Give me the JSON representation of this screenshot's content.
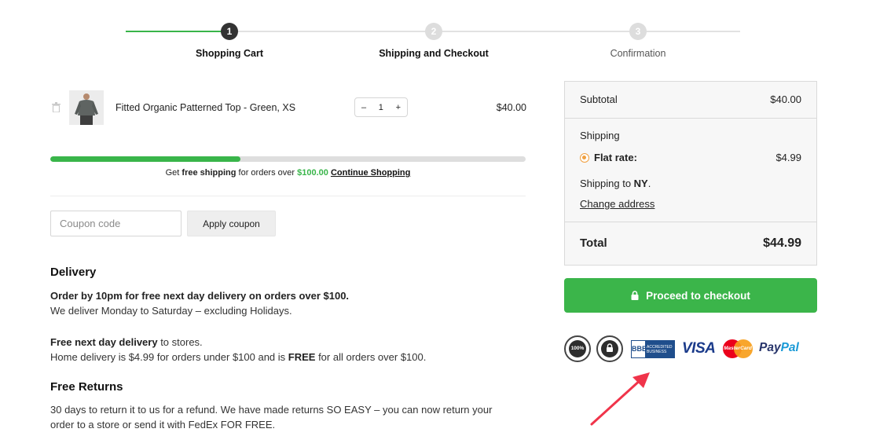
{
  "steps": [
    {
      "number": "1",
      "label": "Shopping Cart",
      "state": "active"
    },
    {
      "number": "2",
      "label": "Shipping and Checkout",
      "state": "upcoming"
    },
    {
      "number": "3",
      "label": "Confirmation",
      "state": "upcoming"
    }
  ],
  "cart": {
    "item": {
      "name": "Fitted Organic Patterned Top - Green, XS",
      "quantity": "1",
      "minus": "–",
      "plus": "+",
      "price": "$40.00",
      "icons": {
        "remove": "trash-icon",
        "thumbnail": "product-thumbnail"
      }
    }
  },
  "free_shipping": {
    "progress": 0.4,
    "text_pre": "Get ",
    "text_bold": "free shipping",
    "text_mid": " for orders over ",
    "threshold": "$100.00",
    "link": "Continue Shopping"
  },
  "coupon": {
    "placeholder": "Coupon code",
    "button": "Apply coupon"
  },
  "delivery": {
    "heading": "Delivery",
    "line1": "Order by 10pm for free next day delivery on orders over $100.",
    "line2": "We deliver Monday to Saturday – excluding Holidays.",
    "line3_bold": "Free next day delivery",
    "line3_rest": " to stores.",
    "line4_pre": "Home delivery is $4.99 for orders under $100 and is ",
    "line4_bold": "FREE",
    "line4_post": " for all orders over $100."
  },
  "returns": {
    "heading": "Free Returns",
    "line1": "30 days to return it to us for a refund. We have made returns SO EASY – you can now return your",
    "line2": "order to a store or send it with FedEx FOR FREE."
  },
  "totals": {
    "subtotal_label": "Subtotal",
    "subtotal_value": "$40.00",
    "shipping_label": "Shipping",
    "flat_rate_label": "Flat rate:",
    "flat_rate_value": "$4.99",
    "shipping_to_pre": "Shipping to ",
    "shipping_to_state": "NY",
    "shipping_to_post": ".",
    "change_address": "Change address",
    "total_label": "Total",
    "total_value": "$44.99"
  },
  "checkout": {
    "button": "Proceed to checkout",
    "icon": "lock-icon"
  },
  "badges": {
    "seal1": "100%",
    "bbb_logo": "BBB",
    "bbb_line1": "ACCREDITED",
    "bbb_line2": "BUSINESS",
    "visa": "VISA",
    "mastercard": "MasterCard",
    "paypal_1": "Pay",
    "paypal_2": "Pal"
  },
  "colors": {
    "accent_green": "#39b54a",
    "step_active": "#333333",
    "step_inactive": "#dddddd",
    "annotation_arrow": "#f0344a"
  }
}
